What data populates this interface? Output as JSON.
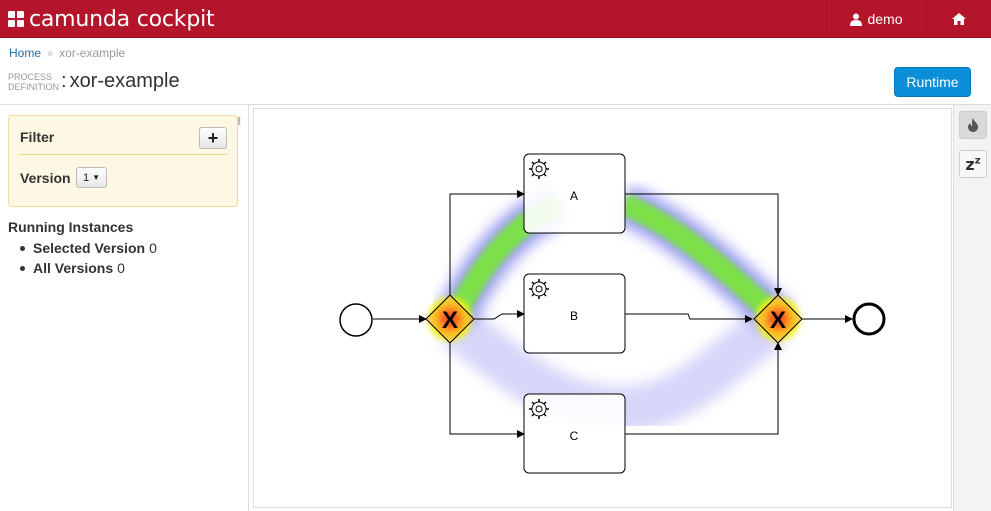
{
  "header": {
    "brand": "camunda cockpit",
    "user": "demo"
  },
  "breadcrumb": {
    "home": "Home",
    "separator": "»",
    "current": "xor-example"
  },
  "title": {
    "prefix_line1": "PROCESS",
    "prefix_line2": "DEFINITION",
    "colon": ":",
    "name": "xor-example"
  },
  "actions": {
    "runtime": "Runtime"
  },
  "sidebar": {
    "filter_title": "Filter",
    "add_label": "+",
    "version_label": "Version",
    "version_value": "1",
    "running_title": "Running Instances",
    "items": [
      {
        "label": "Selected Version",
        "value": "0"
      },
      {
        "label": "All Versions",
        "value": "0"
      }
    ]
  },
  "diagram": {
    "tasks": [
      "A",
      "B",
      "C"
    ],
    "gateway_symbol": "X"
  },
  "tools": {
    "heatmap_icon": "flame-icon",
    "sleep_icon": "zz-icon",
    "sleep_label": "z"
  },
  "colors": {
    "brand": "#b5152b",
    "primary_button": "#0a8fd8",
    "filter_bg": "#fdf8e4"
  }
}
